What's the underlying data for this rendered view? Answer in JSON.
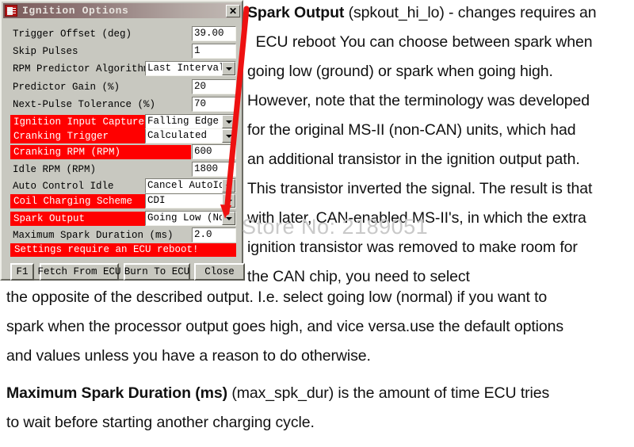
{
  "dialog": {
    "title": "Ignition Options",
    "icon": "app-icon",
    "close_label": "✕",
    "fields": [
      {
        "label": "Trigger Offset (deg)",
        "highlighted": false,
        "control": "text",
        "value": "39.00"
      },
      {
        "label": "Skip Pulses",
        "highlighted": false,
        "control": "text",
        "value": "1"
      },
      {
        "label": "RPM Predictor Algorithm",
        "highlighted": false,
        "control": "dropdown",
        "value": "Last Interval"
      },
      {
        "label": "Predictor Gain (%)",
        "highlighted": false,
        "control": "text",
        "value": "20"
      },
      {
        "label": "Next-Pulse Tolerance (%)",
        "highlighted": false,
        "control": "text",
        "value": "70"
      },
      {
        "label": "Ignition Input Capture",
        "highlighted": true,
        "control": "dropdown",
        "value": "Falling Edge"
      },
      {
        "label": "Cranking Trigger",
        "highlighted": true,
        "control": "dropdown",
        "value": "Calculated"
      },
      {
        "label": "Cranking RPM (RPM)",
        "highlighted": true,
        "control": "text",
        "value": "600"
      },
      {
        "label": "Idle RPM (RPM)",
        "highlighted": false,
        "control": "text",
        "value": "1800"
      },
      {
        "label": "Auto Control Idle",
        "highlighted": false,
        "control": "dropdown",
        "value": "Cancel AutoIdle"
      },
      {
        "label": "Coil Charging Scheme",
        "highlighted": true,
        "control": "dropdown",
        "value": "CDI"
      },
      {
        "label": "Spark Output",
        "highlighted": true,
        "control": "dropdown",
        "value": "Going Low  (Norm"
      },
      {
        "label": "Maximum Spark Duration (ms)",
        "highlighted": false,
        "control": "text",
        "value": "2.0"
      }
    ],
    "warning": "Settings require an ECU reboot!",
    "buttons": [
      {
        "label": "F1"
      },
      {
        "label": "Fetch From ECU"
      },
      {
        "label": "Burn To ECU"
      },
      {
        "label": "Close"
      }
    ]
  },
  "article": {
    "right_column_lines": [
      {
        "bold": "Spark Output",
        "rest": " (spkout_hi_lo) - changes requires an"
      },
      {
        "bold": "",
        "rest": "  ECU  reboot You can choose between spark when"
      },
      {
        "bold": "",
        "rest": "going low (ground) or spark when going high."
      },
      {
        "bold": "",
        "rest": "However, note that the terminology was developed"
      },
      {
        "bold": "",
        "rest": "for the original MS-II (non-CAN) units, which had"
      },
      {
        "bold": "",
        "rest": "an additional transistor in the ignition output path."
      },
      {
        "bold": "",
        "rest": "This transistor inverted the signal. The result is that"
      },
      {
        "bold": "",
        "rest": "with later, CAN-enabled MS-II's, in which the extra"
      },
      {
        "bold": "",
        "rest": "ignition transistor was removed to make room for"
      },
      {
        "bold": "",
        "rest": "the CAN chip, you need to select"
      }
    ],
    "paragraph_2_lines": [
      {
        "bold": "",
        "rest": "the opposite of the described output. I.e. select going low (normal) if you want to"
      },
      {
        "bold": "",
        "rest": "spark when the processor output goes high, and vice versa.use the default options"
      },
      {
        "bold": "",
        "rest": "and values unless you have a reason to do otherwise."
      }
    ],
    "paragraph_3_lines": [
      {
        "bold": "Maximum Spark Duration (ms)",
        "rest": " (max_spk_dur) is the amount of time ECU tries"
      },
      {
        "bold": "",
        "rest": "to wait before starting another charging cycle."
      }
    ]
  },
  "watermark": {
    "text": "Store No: 2189051"
  },
  "annotation": {
    "arrow_color": "#ee1111",
    "name": "red-pointer-arrow"
  },
  "colors": {
    "highlight": "#ff0000",
    "dialog_face": "#c8c8c0",
    "title_bar_start": "#7a5a5a",
    "title_bar_end": "#c2bab5"
  }
}
